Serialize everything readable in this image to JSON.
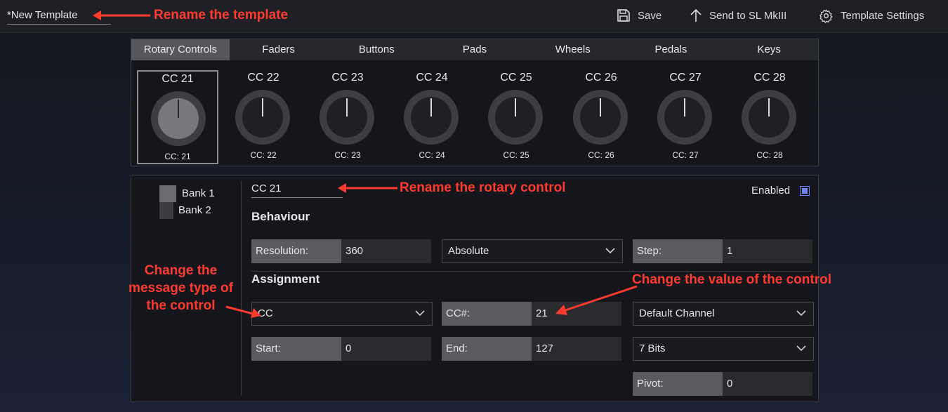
{
  "topbar": {
    "template_name": "*New Template",
    "save_label": "Save",
    "send_label": "Send to SL MkIII",
    "settings_label": "Template Settings"
  },
  "annotations": {
    "rename_template": "Rename the template",
    "rename_control": "Rename the rotary control",
    "message_type_1": "Change the",
    "message_type_2": "message type of",
    "message_type_3": "the control",
    "change_value": "Change the value of the control"
  },
  "tabs": [
    {
      "label": "Rotary Controls",
      "active": true
    },
    {
      "label": "Faders"
    },
    {
      "label": "Buttons"
    },
    {
      "label": "Pads"
    },
    {
      "label": "Wheels"
    },
    {
      "label": "Pedals"
    },
    {
      "label": "Keys"
    }
  ],
  "knobs": [
    {
      "title": "CC 21",
      "sub": "CC: 21",
      "selected": true
    },
    {
      "title": "CC 22",
      "sub": "CC: 22"
    },
    {
      "title": "CC 23",
      "sub": "CC: 23"
    },
    {
      "title": "CC 24",
      "sub": "CC: 24"
    },
    {
      "title": "CC 25",
      "sub": "CC: 25"
    },
    {
      "title": "CC 26",
      "sub": "CC: 26"
    },
    {
      "title": "CC 27",
      "sub": "CC: 27"
    },
    {
      "title": "CC 28",
      "sub": "CC: 28"
    }
  ],
  "banks": [
    {
      "label": "Bank 1",
      "selected": true
    },
    {
      "label": "Bank 2"
    }
  ],
  "control": {
    "name": "CC 21",
    "enabled_label": "Enabled",
    "enabled": true
  },
  "behaviour": {
    "heading": "Behaviour",
    "resolution_label": "Resolution:",
    "resolution_value": "360",
    "mode_value": "Absolute",
    "step_label": "Step:",
    "step_value": "1"
  },
  "assignment": {
    "heading": "Assignment",
    "type_value": "CC",
    "cc_label": "CC#:",
    "cc_value": "21",
    "channel_value": "Default Channel",
    "start_label": "Start:",
    "start_value": "0",
    "end_label": "End:",
    "end_value": "127",
    "bits_value": "7 Bits",
    "pivot_label": "Pivot:",
    "pivot_value": "0"
  },
  "colors": {
    "annotation": "#ff3b30",
    "accent": "#6f86ff"
  }
}
